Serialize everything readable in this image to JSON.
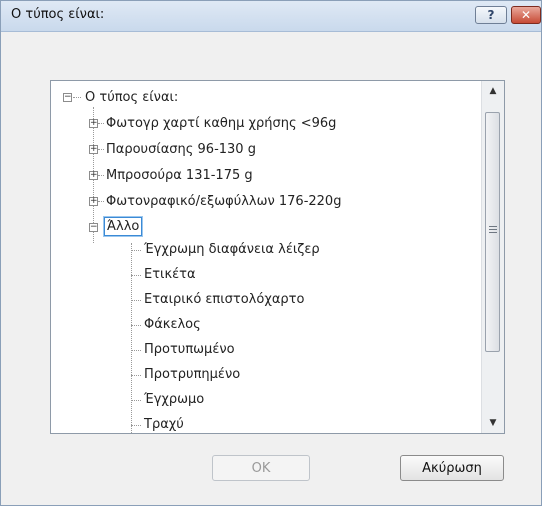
{
  "window": {
    "title": "Ο τύπος είναι:",
    "help_label": "?",
    "close_label": "✕"
  },
  "tree": {
    "root": {
      "label": "Ο τύπος είναι:",
      "expander": "−"
    },
    "categories": [
      {
        "label": "Φωτογρ χαρτί καθημ χρήσης <96g",
        "expander": "+"
      },
      {
        "label": "Παρουσίασης 96-130 g",
        "expander": "+"
      },
      {
        "label": "Μπροσούρα 131-175 g",
        "expander": "+"
      },
      {
        "label": "Φωτονραφικό/εξωφύλλων 176-220g",
        "expander": "+"
      },
      {
        "label": "Άλλο",
        "expander": "−",
        "selected": true
      }
    ],
    "children": [
      "Έγχρωμη διαφάνεια λέιζερ",
      "Ετικέτα",
      "Εταιρικό επιστολόχαρτο",
      "Φάκελος",
      "Προτυπωμένο",
      "Προτρυπημένο",
      "Έγχρωμο",
      "Τραχύ"
    ]
  },
  "scrollbar": {
    "up_arrow": "▲",
    "down_arrow": "▼",
    "position_fraction": 0.0
  },
  "buttons": {
    "ok": "OK",
    "cancel": "Ακύρωση"
  }
}
